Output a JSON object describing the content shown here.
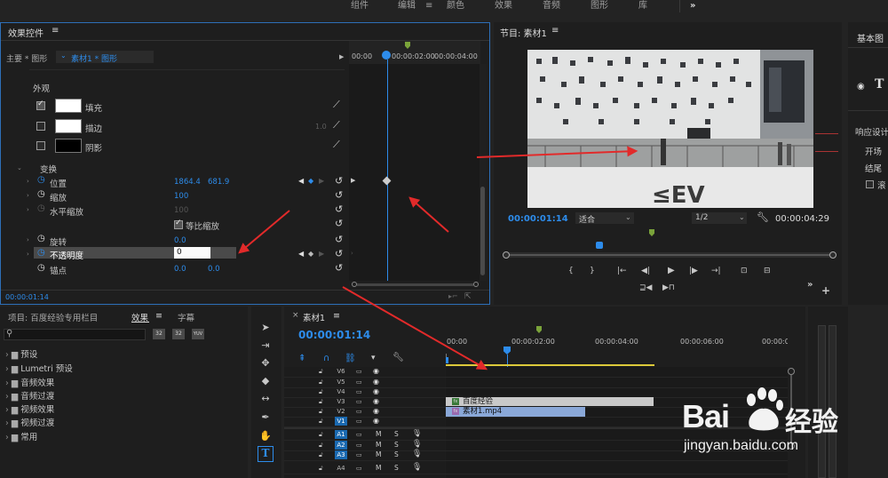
{
  "workspace_tabs": [
    "组件",
    "编辑",
    "颜色",
    "效果",
    "音频",
    "图形",
    "库"
  ],
  "workspace_active": "编辑",
  "workspace_menu_icon": "≡",
  "workspace_more": "»",
  "effect_controls": {
    "title": "效果控件",
    "menu": "≡",
    "master": "主要 * 图形",
    "clip": "素材1 * 图形",
    "ruler": [
      "00:00",
      "00:00:02:00",
      "00:00:04:00"
    ],
    "section_appearance": "外观",
    "fill_label": "填充",
    "stroke_label": "描边",
    "stroke_value": "1.0",
    "shadow_label": "阴影",
    "section_transform": "变换",
    "position_label": "位置",
    "position_x": "1864.4",
    "position_y": "681.9",
    "scale_label": "缩放",
    "scale_value": "100",
    "scale_width_label": "水平缩放",
    "scale_width_value": "100",
    "uniform_label": "等比缩放",
    "rotation_label": "旋转",
    "rotation_value": "0.0",
    "opacity_label": "不透明度",
    "opacity_value": "0",
    "anchor_label": "锚点",
    "anchor_x": "0.0",
    "anchor_y": "0.0",
    "timecode": "00:00:01:14"
  },
  "program_monitor": {
    "title": "节目: 素材1",
    "menu": "≡",
    "timecode": "00:00:01:14",
    "fit": "适合",
    "resolution": "1/2",
    "duration": "00:00:04:29",
    "controls": [
      "{",
      "}",
      "|←",
      "◀|",
      "◀",
      "▶",
      "|▶",
      "→|",
      "⊡",
      "⊟"
    ],
    "controls2": [
      "⊒◀",
      "▶⊓"
    ],
    "more": "»",
    "add": "+"
  },
  "essential_graphics": {
    "title": "基本图",
    "t_icon": "T",
    "responsive": "响应设计",
    "start": "开场",
    "end": "结尾",
    "roll": "滚"
  },
  "project": {
    "title": "项目: 百度经验专用栏目",
    "effects_tab": "效果",
    "menu": "≡",
    "captions_tab": "字幕",
    "search_icon": "⚲",
    "items": [
      "预设",
      "Lumetri 预设",
      "音频效果",
      "音频过渡",
      "视频效果",
      "视频过渡",
      "常用"
    ],
    "badges": [
      "32",
      "32",
      "YUV"
    ]
  },
  "timeline": {
    "close": "×",
    "title": "素材1",
    "menu": "≡",
    "timecode": "00:00:01:14",
    "ruler": [
      "00:00",
      "00:00:02:00",
      "00:00:04:00",
      "00:00:06:00",
      "00:00:0"
    ],
    "video_tracks": [
      "V6",
      "V5",
      "V4",
      "V3",
      "V2",
      "V1"
    ],
    "audio_tracks": [
      "A1",
      "A2",
      "A3",
      "A4"
    ],
    "m": "M",
    "s": "S",
    "clip_v3": "百度经验",
    "clip_v2": "素材1.mp4",
    "clip_badge_v3": "fx",
    "clip_badge_v2": "fx"
  },
  "watermark": {
    "brand": "Bai",
    "brand2": "经验",
    "url": "jingyan.baidu.com"
  },
  "colors": {
    "accent": "#2d8ceb",
    "annotation": "#e22a2a",
    "clip_v3": "#c9c9c9",
    "clip_v2": "#8aa8d8",
    "track_selected": "#1a69b0",
    "in_out": "#dcc93a"
  }
}
